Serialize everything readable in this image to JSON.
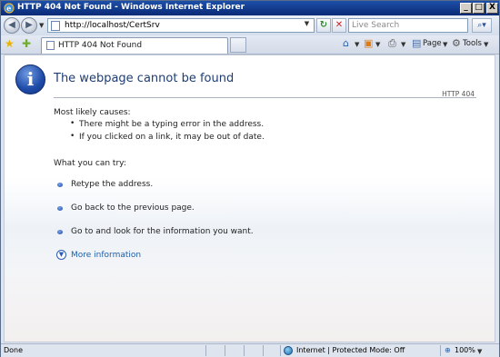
{
  "window": {
    "title": "HTTP 404 Not Found - Windows Internet Explorer",
    "minimize": "_",
    "maximize": "□",
    "close": "X"
  },
  "address": {
    "url": "http://localhost/CertSrv",
    "search_placeholder": "Live Search"
  },
  "tab": {
    "label": "HTTP 404 Not Found"
  },
  "commands": {
    "page": "Page",
    "tools": "Tools"
  },
  "content": {
    "title": "The webpage cannot be found",
    "code": "HTTP 404",
    "causes_heading": "Most likely causes:",
    "causes": [
      "There might be a typing error in the address.",
      "If you clicked on a link, it may be out of date."
    ],
    "try_heading": "What you can try:",
    "try_items": [
      "Retype the address.",
      "Go back to the previous page.",
      "Go to  and look for the information you want."
    ],
    "more_info": "More information"
  },
  "status": {
    "left": "Done",
    "zone": "Internet | Protected Mode: Off",
    "zoom": "100%"
  },
  "colors": {
    "titlebar": "#0a2a76",
    "link": "#1f5ea8",
    "heading": "#1f3d73"
  }
}
